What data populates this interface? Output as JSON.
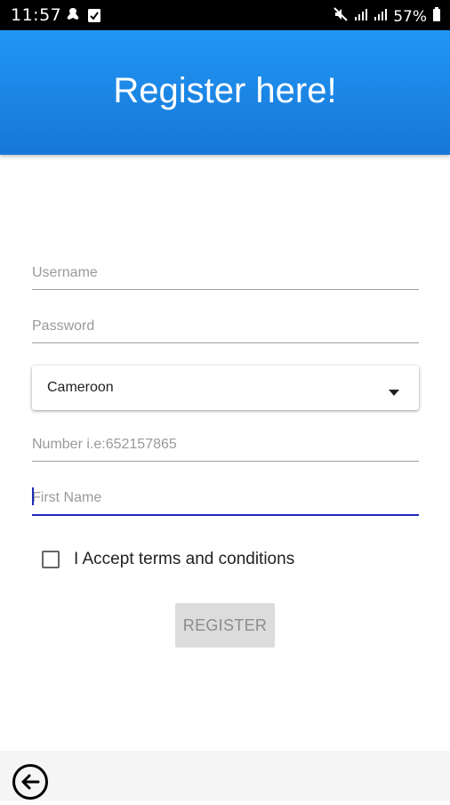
{
  "status_bar": {
    "time": "11:57",
    "battery": "57%",
    "icons": [
      "notification-icon",
      "checklist-icon",
      "mute-icon",
      "signal-icon",
      "signal-icon",
      "battery-icon"
    ]
  },
  "header": {
    "title": "Register here!"
  },
  "form": {
    "username_placeholder": "Username",
    "password_placeholder": "Password",
    "country_value": "Cameroon",
    "number_placeholder": "Number i.e:652157865",
    "first_name_placeholder": "First Name",
    "terms_label": "I Accept terms and conditions",
    "terms_checked": false,
    "register_label": "REGISTER"
  },
  "colors": {
    "header_blue": "#2196f3",
    "focus_underline": "#1f2ab8",
    "disabled_button": "#dcdcdc"
  }
}
